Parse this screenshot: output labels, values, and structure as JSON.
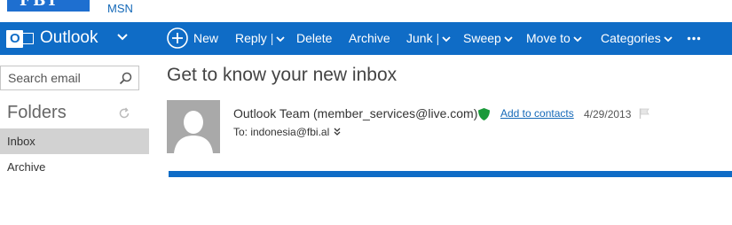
{
  "brand": {
    "logo_text": "FBI",
    "msn_link": "MSN"
  },
  "appbar": {
    "title": "Outlook",
    "commands": {
      "new": "New",
      "reply": "Reply",
      "delete": "Delete",
      "archive": "Archive",
      "junk": "Junk",
      "sweep": "Sweep",
      "move_to": "Move to",
      "categories": "Categories"
    },
    "color": "#0f6cc6"
  },
  "search": {
    "placeholder": "Search email"
  },
  "folders": {
    "heading": "Folders",
    "items": [
      {
        "label": "Inbox",
        "selected": true
      },
      {
        "label": "Archive",
        "selected": false
      }
    ]
  },
  "message": {
    "subject": "Get to know your new inbox",
    "sender": "Outlook Team (member_services@live.com)",
    "add_to_contacts": "Add to contacts",
    "date": "4/29/2013",
    "to_line": "To: indonesia@fbi.al",
    "icons": [
      "avatar-silhouette",
      "shield-icon",
      "flag-icon",
      "expand-icon"
    ]
  }
}
